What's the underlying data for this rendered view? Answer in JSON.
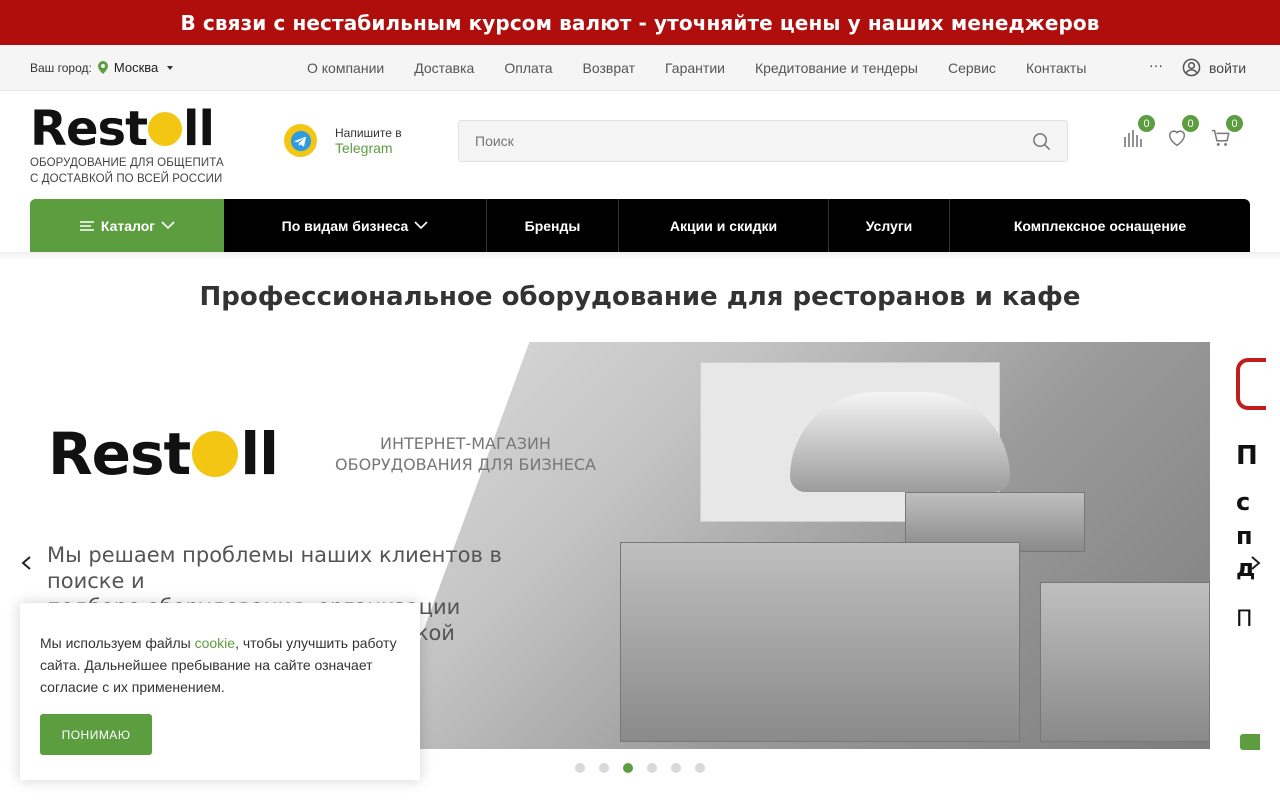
{
  "banner": {
    "text": "В связи с нестабильным курсом валют - уточняйте цены у наших менеджеров",
    "color": "#b00d0d"
  },
  "topbar": {
    "city_label": "Ваш город:",
    "city": "Москва",
    "nav": [
      "О компании",
      "Доставка",
      "Оплата",
      "Возврат",
      "Гарантии",
      "Кредитование и тендеры",
      "Сервис",
      "Контакты"
    ],
    "more": "···",
    "login": "войти"
  },
  "header": {
    "logo": {
      "left": "Rest",
      "right": "ll",
      "tagline_1": "ОБОРУДОВАНИЕ ДЛЯ ОБЩЕПИТА",
      "tagline_2": "С ДОСТАВКОЙ ПО ВСЕЙ РОССИИ"
    },
    "telegram": {
      "line1": "Напишите в",
      "line2": "Telegram"
    },
    "search": {
      "placeholder": "Поиск"
    },
    "counters": {
      "compare": "0",
      "favorites": "0",
      "cart": "0"
    }
  },
  "mainnav": {
    "catalog": "Каталог",
    "business": "По видам бизнеса",
    "brands": "Бренды",
    "sales": "Акции и скидки",
    "services": "Услуги",
    "complex": "Комплексное оснащение"
  },
  "page": {
    "title": "Профессиональное оборудование для ресторанов и кафе"
  },
  "slide": {
    "brand_left": "Rest",
    "brand_right": "ll",
    "store_1": "ИНТЕРНЕТ-МАГАЗИН",
    "store_2": "ОБОРУДОВАНИЯ ДЛЯ БИЗНЕСА",
    "claim_1": "Мы решаем проблемы наших клиентов в поиске и",
    "claim_2": "подбоpe оборудования, организации",
    "claim_3": "оперативной доставки, технической поддержке",
    "dots_total": 6,
    "dots_active": 3
  },
  "next_slide_peek": {
    "l1": "П",
    "l2": "с",
    "l3": "п",
    "l4": "д",
    "l5": "П"
  },
  "cookie": {
    "text_before": "Мы используем файлы ",
    "link": "cookie",
    "text_after": ", чтобы улучшить работу сайта. Дальнейшее пребывание на сайте означает согласие с их применением.",
    "button": "ПОНИМАЮ"
  },
  "colors": {
    "accent": "#5c9e3f",
    "nav_bg": "#000000",
    "logo_yellow": "#f3c613"
  }
}
